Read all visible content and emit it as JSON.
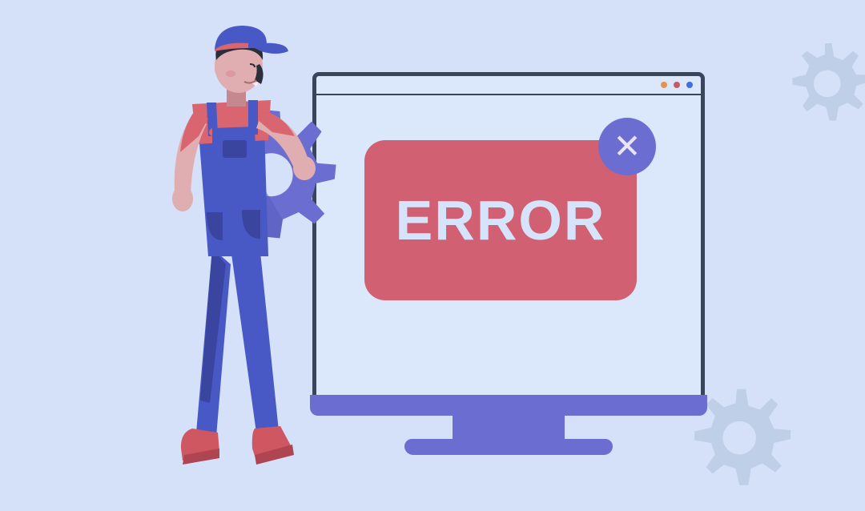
{
  "dialog": {
    "error_text": "ERROR",
    "close_glyph": "✕"
  },
  "titlebar": {
    "dots": [
      "orange",
      "red",
      "blue"
    ]
  },
  "colors": {
    "background": "#d4e1f9",
    "monitor_border": "#39455b",
    "monitor_screen": "#dbe7fb",
    "purple": "#6b6ed0",
    "error_red": "#d06072",
    "error_text": "#d5e3fb",
    "skin": "#e0aeb0",
    "skin_shadow": "#c6888f",
    "shirt": "#d86570",
    "overalls": "#4859c6",
    "overalls_dark": "#39459e",
    "hair": "#2a2f3a",
    "boots": "#ce5762",
    "gear_light": "#c0cfe8"
  }
}
